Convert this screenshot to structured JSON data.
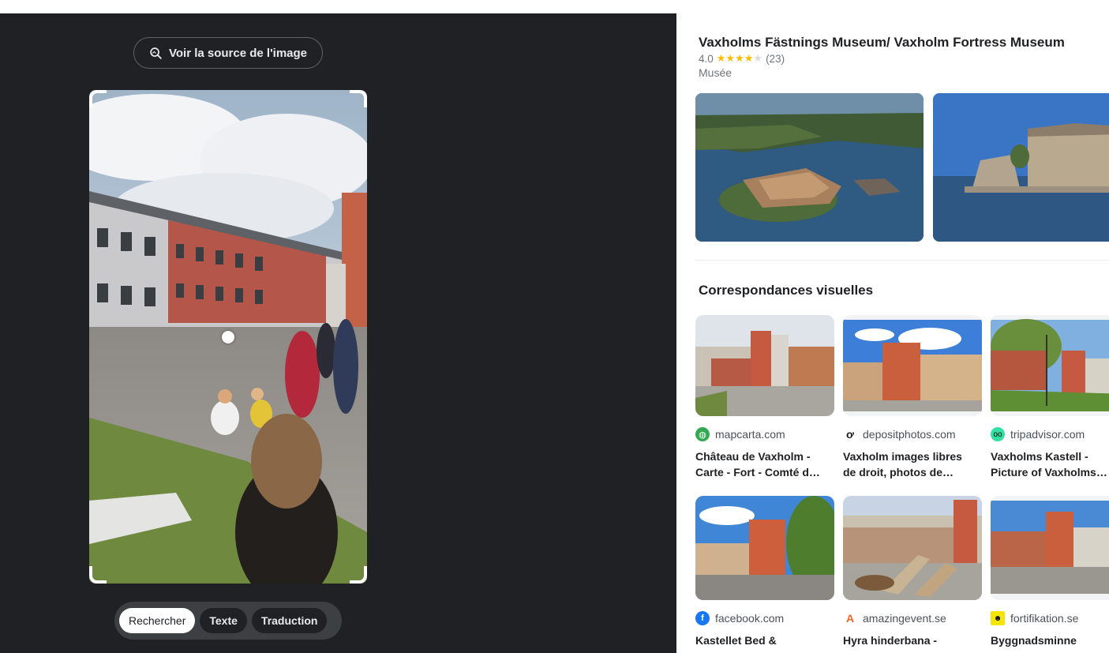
{
  "viewer": {
    "source_button": "Voir la source de l'image",
    "modes": [
      {
        "label": "Rechercher",
        "active": true
      },
      {
        "label": "Texte",
        "active": false
      },
      {
        "label": "Traduction",
        "active": false
      }
    ]
  },
  "knowledge_panel": {
    "title": "Vaxholms Fästnings Museum/ Vaxholm Fortress Museum",
    "rating": "4.0",
    "stars_filled": 4,
    "review_count": "(23)",
    "type": "Musée"
  },
  "visual_matches": {
    "section_title": "Correspondances visuelles",
    "items": [
      {
        "source": "mapcarta.com",
        "title_line1": "Château de Vaxholm -",
        "title_line2": "Carte - Fort - Comté d…",
        "favicon": "globe-icon",
        "favicon_color": "#34a853"
      },
      {
        "source": "depositphotos.com",
        "title_line1": "Vaxholm images libres",
        "title_line2": "de droit, photos de…",
        "favicon": "depositphotos-icon",
        "favicon_color": "#202124"
      },
      {
        "source": "tripadvisor.com",
        "title_line1": "Vaxholms Kastell -",
        "title_line2": "Picture of Vaxholms…",
        "favicon": "owl-icon",
        "favicon_color": "#34e0a1"
      },
      {
        "source": "facebook.com",
        "title_line1": "Kastellet Bed &",
        "title_line2": "",
        "favicon": "facebook-icon",
        "favicon_color": "#1877f2"
      },
      {
        "source": "amazingevent.se",
        "title_line1": "Hyra hinderbana -",
        "title_line2": "",
        "favicon": "amazingevent-icon",
        "favicon_color": "#f26522"
      },
      {
        "source": "fortifikation.se",
        "title_line1": "Byggnadsminne",
        "title_line2": "",
        "favicon": "fortifikation-icon",
        "favicon_color": "#f4e500"
      }
    ]
  }
}
